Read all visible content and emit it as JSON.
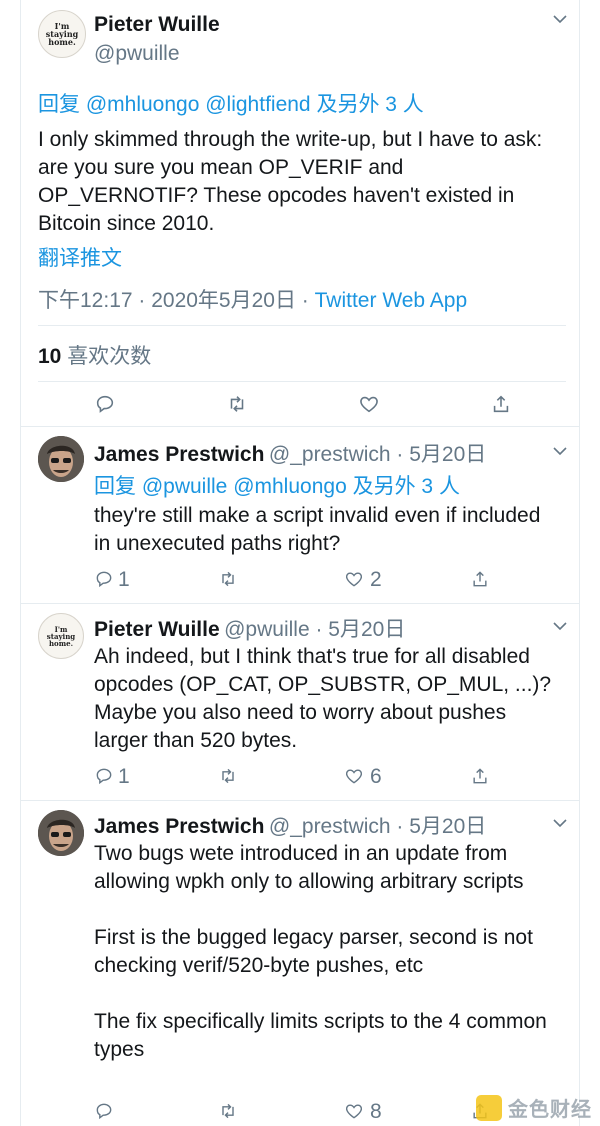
{
  "main_tweet": {
    "avatar_text": "I'm staying home.",
    "name": "Pieter Wuille",
    "handle": "@pwuille",
    "reply_prefix": "回复",
    "reply_mentions": "@mhluongo @lightfiend",
    "reply_suffix": "及另外 3 人",
    "text": "I only skimmed through the write-up, but I have to ask: are you sure you mean OP_VERIF and OP_VERNOTIF? These opcodes haven't existed in Bitcoin since 2010.",
    "translate": "翻译推文",
    "timestamp": "下午12:17 · 2020年5月20日 · ",
    "source": "Twitter Web App",
    "likes_count": "10",
    "likes_label": "喜欢次数"
  },
  "replies": [
    {
      "name": "James Prestwich",
      "handle": "@_prestwich · 5月20日",
      "reply_prefix": "回复",
      "reply_mentions": "@pwuille @mhluongo",
      "reply_suffix": "及另外 3 人",
      "text": "they're still make a script invalid even if included in unexecuted paths right?",
      "reply_count": "1",
      "retweet_count": "",
      "like_count": "2"
    },
    {
      "avatar_text": "I'm staying home.",
      "name": "Pieter Wuille",
      "handle": "@pwuille · 5月20日",
      "text": "Ah indeed, but I think that's true for all disabled opcodes (OP_CAT, OP_SUBSTR, OP_MUL, ...)? Maybe you also need to worry about pushes larger than 520 bytes.",
      "reply_count": "1",
      "retweet_count": "",
      "like_count": "6"
    },
    {
      "name": "James Prestwich",
      "handle": "@_prestwich · 5月20日",
      "text": "Two bugs wete introduced in an update from allowing wpkh only to allowing arbitrary scripts\n\nFirst is the bugged legacy parser, second is not checking verif/520-byte pushes, etc\n\nThe fix specifically limits scripts to the 4 common types",
      "reply_count": "",
      "retweet_count": "",
      "like_count": "8"
    }
  ],
  "watermark": {
    "text": "金色财经"
  },
  "colors": {
    "link": "#1b95e0",
    "muted": "#657786",
    "divider": "#e6ecf0"
  }
}
